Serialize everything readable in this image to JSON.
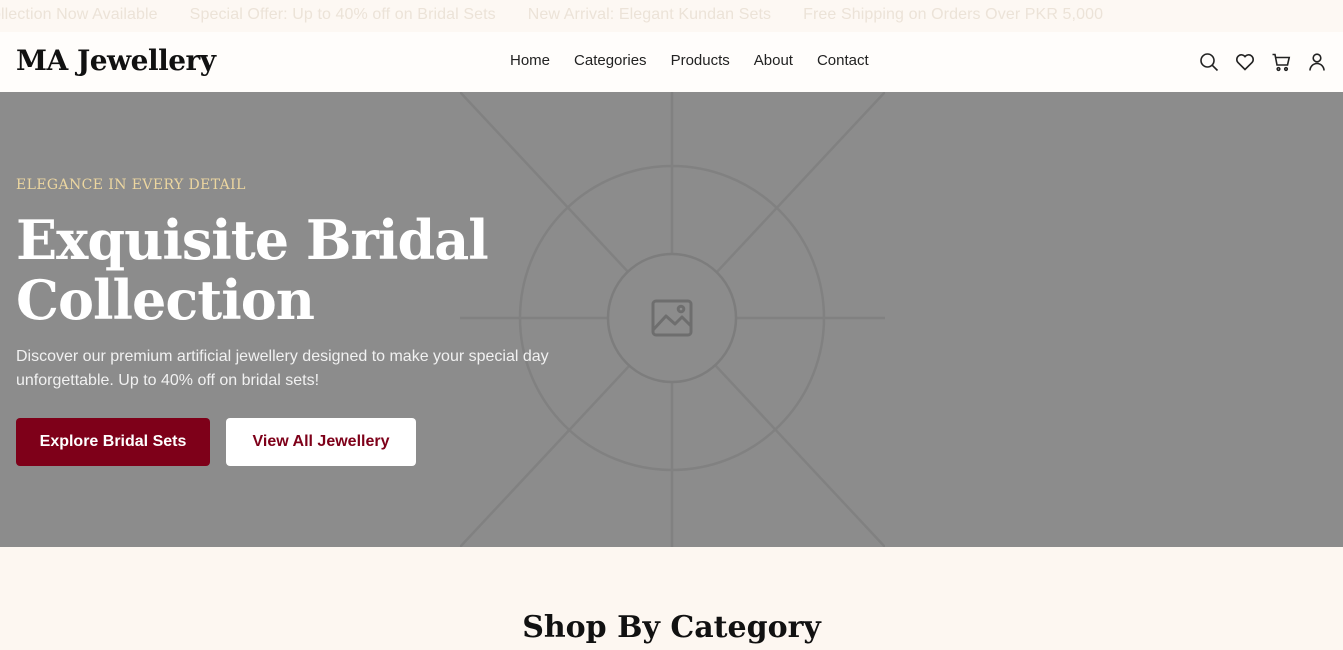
{
  "announcement": {
    "items": [
      "ollection Now Available",
      "Special Offer: Up to 40% off on Bridal Sets",
      "New Arrival: Elegant Kundan Sets",
      "Free Shipping on Orders Over PKR 5,000"
    ]
  },
  "header": {
    "logo": "MA Jewellery",
    "nav": [
      "Home",
      "Categories",
      "Products",
      "About",
      "Contact"
    ],
    "icons": [
      "search-icon",
      "heart-icon",
      "cart-icon",
      "user-icon"
    ]
  },
  "hero": {
    "eyebrow": "ELEGANCE IN EVERY DETAIL",
    "title": "Exquisite Bridal Collection",
    "description": "Discover our premium artificial jewellery designed to make your special day unforgettable. Up to 40% off on bridal sets!",
    "primary_button": "Explore Bridal Sets",
    "secondary_button": "View All Jewellery",
    "image_icon": "image-placeholder-icon"
  },
  "categories_section": {
    "title": "Shop By Category"
  },
  "colors": {
    "accent": "#7e0019",
    "eyebrow": "#ecd6a0",
    "hero_bg": "#8c8c8c",
    "page_bg": "#fdf7f1"
  }
}
